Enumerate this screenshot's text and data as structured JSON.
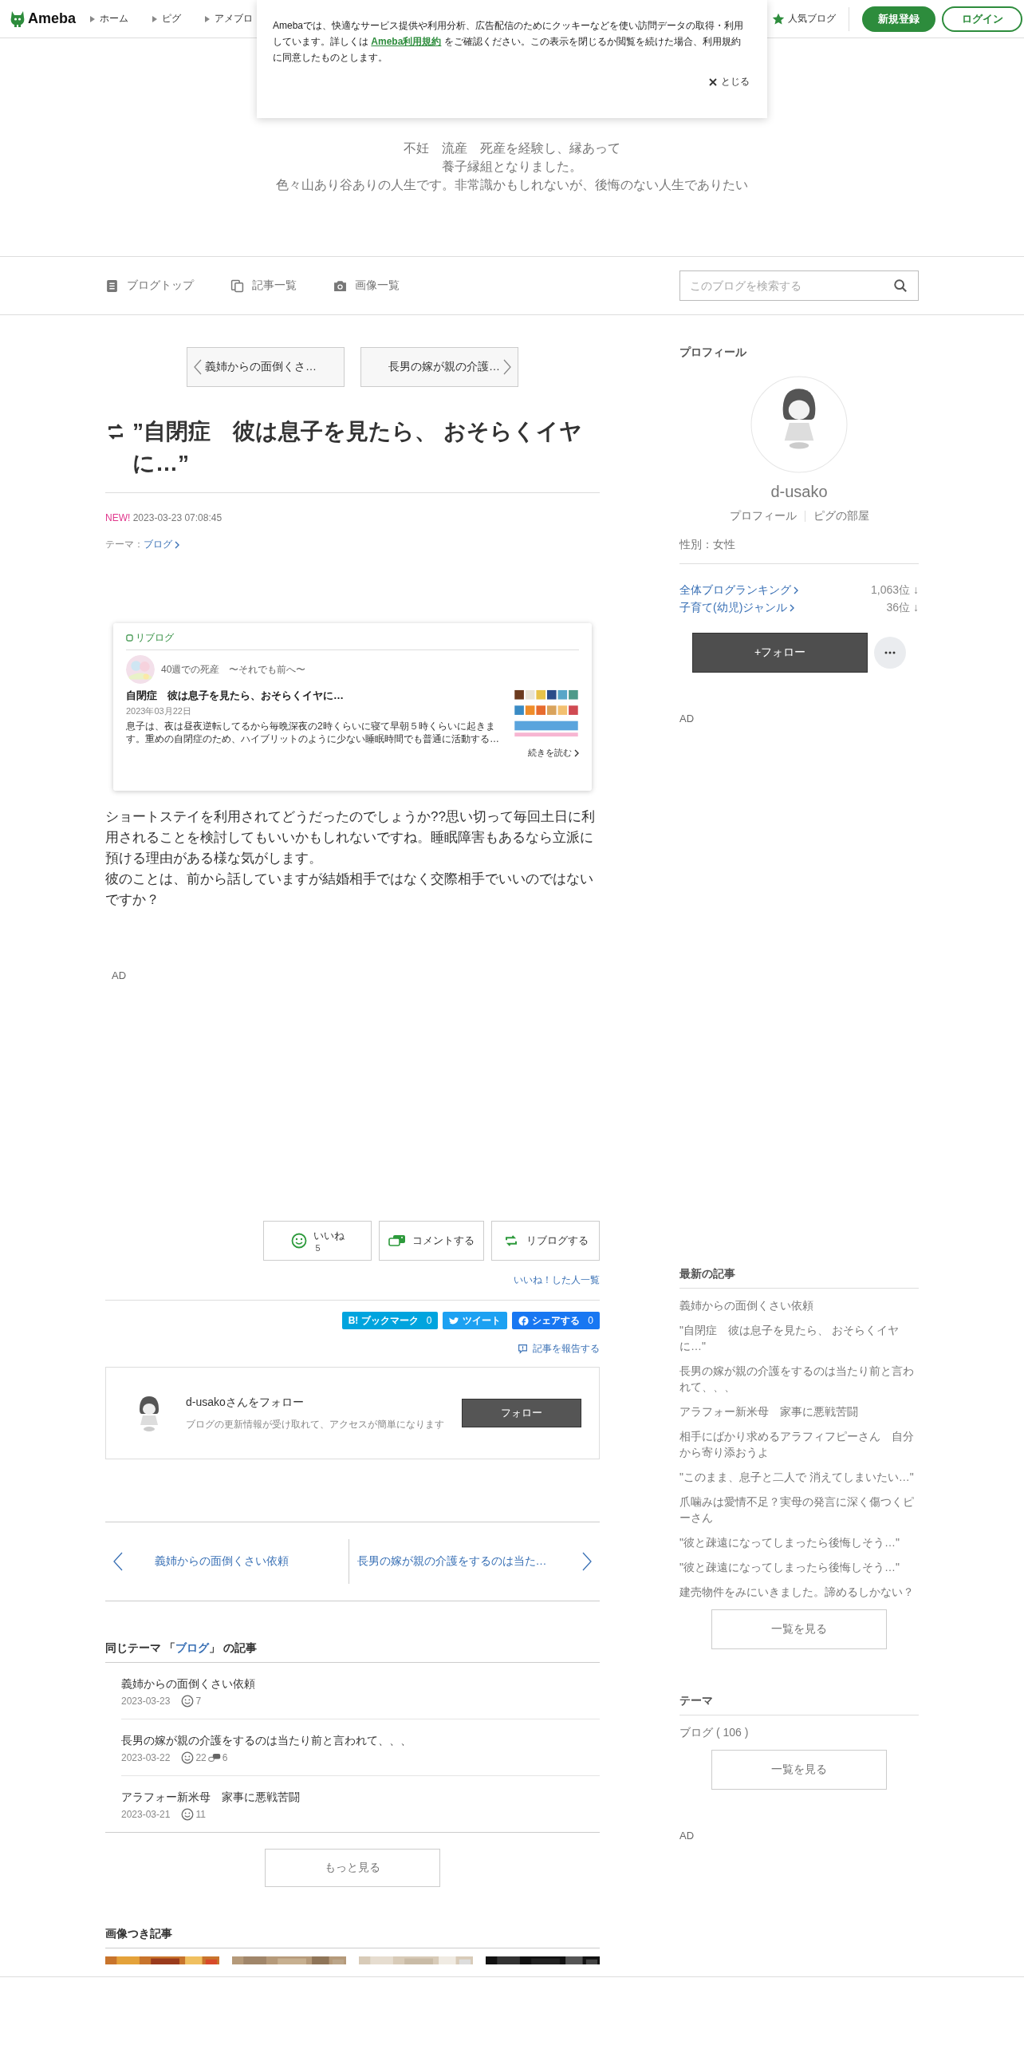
{
  "header": {
    "logo": "Ameba",
    "nav": [
      "ホーム",
      "ピグ",
      "アメブロ"
    ],
    "popular": "人気ブログ",
    "signup": "新規登録",
    "login": "ログイン"
  },
  "cookie_banner": {
    "text_before": "Amebaでは、快適なサービス提供や利用分析、広告配信のためにクッキーなどを使い訪問データの取得・利用しています。詳しくは",
    "link": "Ameba利用規約",
    "text_after": "をご確認ください。この表示を閉じるか閲覧を続けた場合、利用規約に同意したものとします。",
    "close": "とじる"
  },
  "blog_header": {
    "description": [
      "不妊　流産　死産を経験し、縁あって",
      "養子縁組となりました。",
      "色々山あり谷ありの人生です。非常識かもしれないが、後悔のない人生でありたい"
    ]
  },
  "blog_nav": {
    "items": [
      "ブログトップ",
      "記事一覧",
      "画像一覧"
    ],
    "search": {
      "placeholder": "このブログを検索する"
    }
  },
  "article": {
    "pager": [
      {
        "kind": "prev",
        "label": "義姉からの面倒くさ…"
      },
      {
        "kind": "next",
        "label": "長男の嫁が親の介護…"
      }
    ],
    "title": "”自閉症　彼は息子を見たら、 おそらくイヤに…”",
    "new_badge": "NEW!",
    "date": "2023-03-23 07:08:45",
    "theme_label": "テーマ：",
    "theme": "ブログ",
    "reblog": {
      "label": "リブログ",
      "blog_name": "40週での死産　〜それでも前へ〜",
      "title": "自閉症　彼は息子を見たら、おそらくイヤに…",
      "date": "2023年03月22日",
      "excerpt": "息子は、夜は昼夜逆転してるから毎晩深夜の2時くらいに寝て早朝５時くらいに起きます。重めの自閉症のため、ハイブリットのように少ない睡眠時間でも普通に活動する…",
      "more": "続きを読む"
    },
    "body": [
      "ショートステイを利用されてどうだったのでしょうか??思い切って毎回土日に利用されることを検討してもいいかもしれないですね。睡眠障害もあるなら立派に預ける理由がある様な気がします。",
      "彼のことは、前から話していますが結婚相手ではなく交際相手でいいのではないですか？"
    ],
    "ad": "AD",
    "actions": {
      "like": "いいね",
      "like_count": "5",
      "comment": "コメントする",
      "reblog": "リブログする"
    },
    "likers_link": "いいね！した人一覧",
    "share": [
      {
        "kind": "hatena",
        "label": "B! ブックマーク",
        "count": "0"
      },
      {
        "kind": "twitter",
        "label": "ツイート"
      },
      {
        "kind": "facebook",
        "label": "シェアする",
        "count": "0"
      }
    ],
    "report": "記事を報告する",
    "follow_card": {
      "title": "d-usakoさんをフォロー",
      "description": "ブログの更新情報が受け取れて、アクセスが簡単になります",
      "button": "フォロー"
    },
    "post_nav": {
      "prev": "義姉からの面倒くさい依頼",
      "next": "長男の嫁が親の介護をするのは当た…"
    },
    "same_theme": {
      "prefix": "同じテーマ 「",
      "theme": "ブログ",
      "suffix": "」 の記事",
      "items": [
        {
          "title": "義姉からの面倒くさい依頼",
          "date": "2023-03-23",
          "likes": "7"
        },
        {
          "title": "長男の嫁が親の介護をするのは当たり前と言われて、、、",
          "date": "2023-03-22",
          "likes": "22",
          "comments": "6"
        },
        {
          "title": "アラフォー新米母　家事に悪戦苦闘",
          "date": "2023-03-21",
          "likes": "11"
        }
      ],
      "more": "もっと見る"
    },
    "image_articles": {
      "heading": "画像つき記事"
    }
  },
  "sidebar": {
    "profile": {
      "heading": "プロフィール",
      "name": "d-usako",
      "links": [
        "プロフィール",
        "ピグの部屋"
      ],
      "gender": "性別：女性",
      "rankings": [
        {
          "label": "全体ブログランキング",
          "rank": "1,063位 ↓"
        },
        {
          "label": "子育て(幼児)ジャンル",
          "rank": "36位 ↓"
        }
      ],
      "follow": "+フォロー"
    },
    "ad": "AD",
    "latest": {
      "heading": "最新の記事",
      "items": [
        "義姉からの面倒くさい依頼",
        "\"自閉症　彼は息子を見たら、 おそらくイヤに…\"",
        "長男の嫁が親の介護をするのは当たり前と言われて、、、",
        "アラフォー新米母　家事に悪戦苦闘",
        "相手にばかり求めるアラフィフピーさん　自分から寄り添おうよ",
        "\"このまま、息子と二人で 消えてしまいたい…\"",
        "爪噛みは愛情不足？実母の発言に深く傷つくピーさん",
        "\"彼と疎遠になってしまったら後悔しそう…\"",
        "\"彼と疎遠になってしまったら後悔しそう…\"",
        "建売物件をみにいきました。諦めるしかない？"
      ],
      "button": "一覧を見る"
    },
    "themes": {
      "heading": "テーマ",
      "items": [
        "ブログ ( 106 )"
      ],
      "button": "一覧を見る"
    },
    "ad2": "AD"
  }
}
